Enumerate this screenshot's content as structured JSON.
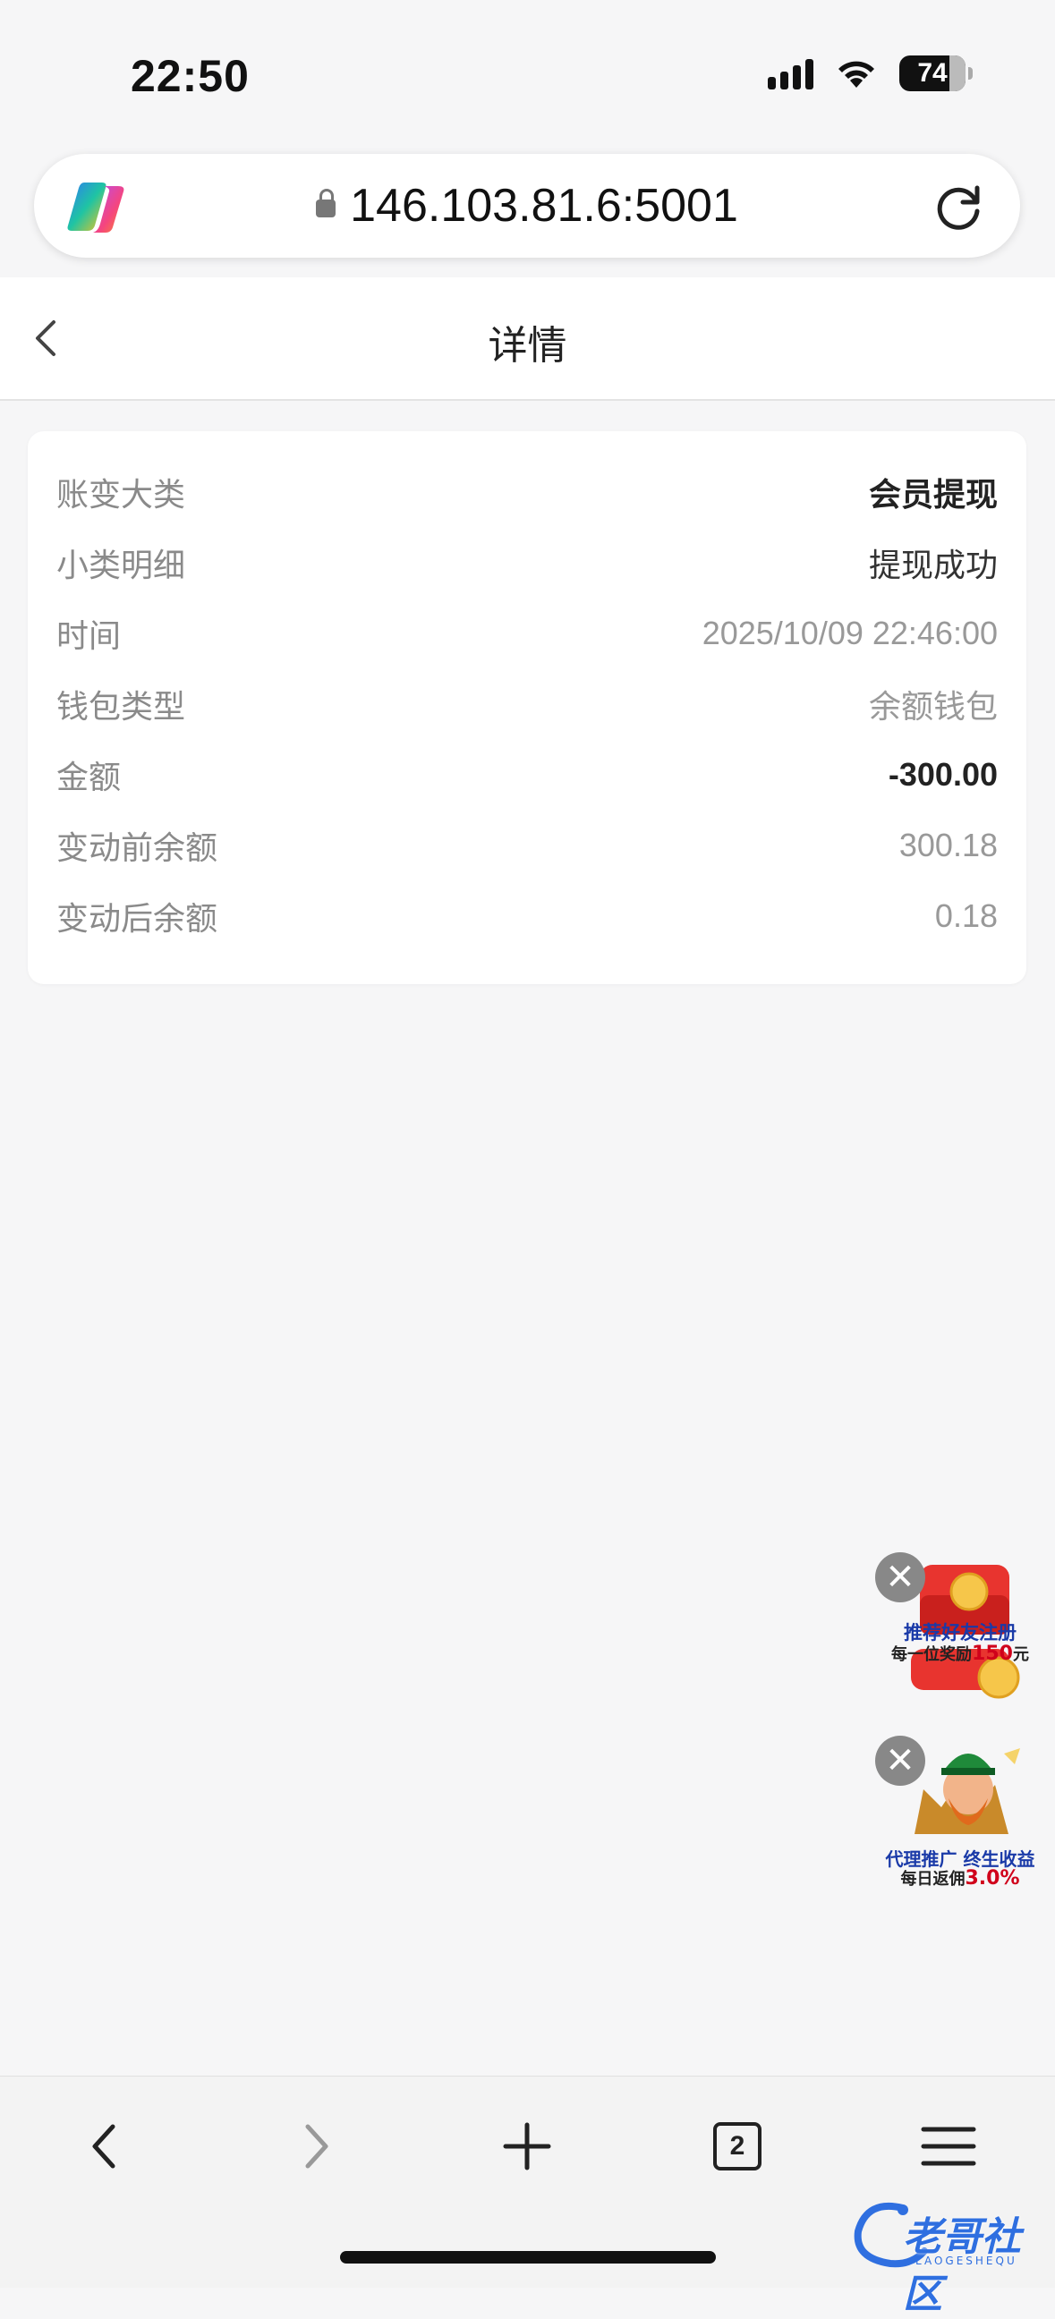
{
  "status_bar": {
    "time": "22:50",
    "battery": "74"
  },
  "browser": {
    "url": "146.103.81.6:5001",
    "icons": [
      "copilot-logo",
      "lock-icon",
      "reload-icon"
    ]
  },
  "header": {
    "title": "详情",
    "back_icon": "chevron-left-icon"
  },
  "details": [
    {
      "label": "账变大类",
      "value": "会员提现"
    },
    {
      "label": "小类明细",
      "value": "提现成功"
    },
    {
      "label": "时间",
      "value": "2025/10/09 22:46:00"
    },
    {
      "label": "钱包类型",
      "value": "余额钱包"
    },
    {
      "label": "金额",
      "value": "-300.00"
    },
    {
      "label": "变动前余额",
      "value": "300.18"
    },
    {
      "label": "变动后余额",
      "value": "0.18"
    }
  ],
  "ads": {
    "referral": {
      "line1": "推荐好友注册",
      "line2_prefix": "每一位奖励",
      "amount": "150",
      "unit": "元"
    },
    "agent": {
      "line1": "代理推广 终生收益",
      "line2_prefix": "每日返佣",
      "rate": "3.0%"
    }
  },
  "toolbar": {
    "tab_count": "2",
    "icons": [
      "back-arrow-icon",
      "forward-arrow-icon",
      "new-tab-icon",
      "tabs-icon",
      "menu-icon"
    ]
  },
  "watermark": {
    "text": "老哥社区",
    "subtext": "LAOGESHEQU"
  },
  "colors": {
    "page_bg": "#f6f6f7",
    "card_bg": "#ffffff",
    "label": "#8a8a8a",
    "value_strong": "#222222",
    "ad_blue": "#1a3aa8",
    "ad_red": "#d0021b"
  }
}
